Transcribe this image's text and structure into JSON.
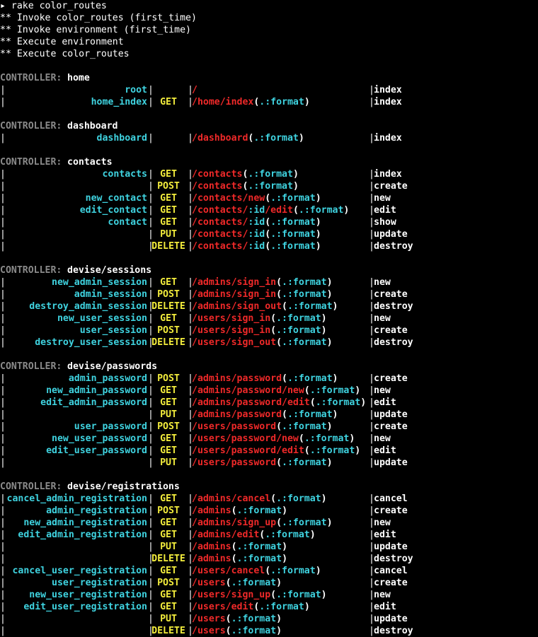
{
  "terminal": {
    "header_lines": [
      "▸ rake color_routes",
      "** Invoke color_routes (first_time)",
      "** Invoke environment (first_time)",
      "** Execute environment",
      "** Execute color_routes"
    ],
    "controller_label": "CONTROLLER:",
    "pipe": "|",
    "controllers": [
      {
        "name": "home",
        "routes": [
          {
            "name": "root",
            "verb": "",
            "path": [
              [
                "r",
                "/"
              ]
            ],
            "action": "index"
          },
          {
            "name": "home_index",
            "verb": "GET",
            "path": [
              [
                "r",
                "/home/index"
              ],
              [
                "w",
                "("
              ],
              [
                "c",
                ".:format"
              ],
              [
                "w",
                ")"
              ]
            ],
            "action": "index"
          }
        ]
      },
      {
        "name": "dashboard",
        "routes": [
          {
            "name": "dashboard",
            "verb": "",
            "path": [
              [
                "r",
                "/dashboard"
              ],
              [
                "w",
                "("
              ],
              [
                "c",
                ".:format"
              ],
              [
                "w",
                ")"
              ]
            ],
            "action": "index"
          }
        ]
      },
      {
        "name": "contacts",
        "routes": [
          {
            "name": "contacts",
            "verb": "GET",
            "path": [
              [
                "r",
                "/contacts"
              ],
              [
                "w",
                "("
              ],
              [
                "c",
                ".:format"
              ],
              [
                "w",
                ")"
              ]
            ],
            "action": "index"
          },
          {
            "name": "",
            "verb": "POST",
            "path": [
              [
                "r",
                "/contacts"
              ],
              [
                "w",
                "("
              ],
              [
                "c",
                ".:format"
              ],
              [
                "w",
                ")"
              ]
            ],
            "action": "create"
          },
          {
            "name": "new_contact",
            "verb": "GET",
            "path": [
              [
                "r",
                "/contacts/new"
              ],
              [
                "w",
                "("
              ],
              [
                "c",
                ".:format"
              ],
              [
                "w",
                ")"
              ]
            ],
            "action": "new"
          },
          {
            "name": "edit_contact",
            "verb": "GET",
            "path": [
              [
                "r",
                "/contacts/"
              ],
              [
                "c",
                ":id"
              ],
              [
                "r",
                "/edit"
              ],
              [
                "w",
                "("
              ],
              [
                "c",
                ".:format"
              ],
              [
                "w",
                ")"
              ]
            ],
            "action": "edit"
          },
          {
            "name": "contact",
            "verb": "GET",
            "path": [
              [
                "r",
                "/contacts/"
              ],
              [
                "c",
                ":id"
              ],
              [
                "w",
                "("
              ],
              [
                "c",
                ".:format"
              ],
              [
                "w",
                ")"
              ]
            ],
            "action": "show"
          },
          {
            "name": "",
            "verb": "PUT",
            "path": [
              [
                "r",
                "/contacts/"
              ],
              [
                "c",
                ":id"
              ],
              [
                "w",
                "("
              ],
              [
                "c",
                ".:format"
              ],
              [
                "w",
                ")"
              ]
            ],
            "action": "update"
          },
          {
            "name": "",
            "verb": "DELETE",
            "path": [
              [
                "r",
                "/contacts/"
              ],
              [
                "c",
                ":id"
              ],
              [
                "w",
                "("
              ],
              [
                "c",
                ".:format"
              ],
              [
                "w",
                ")"
              ]
            ],
            "action": "destroy"
          }
        ]
      },
      {
        "name": "devise/sessions",
        "routes": [
          {
            "name": "new_admin_session",
            "verb": "GET",
            "path": [
              [
                "r",
                "/admins/sign_in"
              ],
              [
                "w",
                "("
              ],
              [
                "c",
                ".:format"
              ],
              [
                "w",
                ")"
              ]
            ],
            "action": "new"
          },
          {
            "name": "admin_session",
            "verb": "POST",
            "path": [
              [
                "r",
                "/admins/sign_in"
              ],
              [
                "w",
                "("
              ],
              [
                "c",
                ".:format"
              ],
              [
                "w",
                ")"
              ]
            ],
            "action": "create"
          },
          {
            "name": "destroy_admin_session",
            "verb": "DELETE",
            "path": [
              [
                "r",
                "/admins/sign_out"
              ],
              [
                "w",
                "("
              ],
              [
                "c",
                ".:format"
              ],
              [
                "w",
                ")"
              ]
            ],
            "action": "destroy"
          },
          {
            "name": "new_user_session",
            "verb": "GET",
            "path": [
              [
                "r",
                "/users/sign_in"
              ],
              [
                "w",
                "("
              ],
              [
                "c",
                ".:format"
              ],
              [
                "w",
                ")"
              ]
            ],
            "action": "new"
          },
          {
            "name": "user_session",
            "verb": "POST",
            "path": [
              [
                "r",
                "/users/sign_in"
              ],
              [
                "w",
                "("
              ],
              [
                "c",
                ".:format"
              ],
              [
                "w",
                ")"
              ]
            ],
            "action": "create"
          },
          {
            "name": "destroy_user_session",
            "verb": "DELETE",
            "path": [
              [
                "r",
                "/users/sign_out"
              ],
              [
                "w",
                "("
              ],
              [
                "c",
                ".:format"
              ],
              [
                "w",
                ")"
              ]
            ],
            "action": "destroy"
          }
        ]
      },
      {
        "name": "devise/passwords",
        "routes": [
          {
            "name": "admin_password",
            "verb": "POST",
            "path": [
              [
                "r",
                "/admins/password"
              ],
              [
                "w",
                "("
              ],
              [
                "c",
                ".:format"
              ],
              [
                "w",
                ")"
              ]
            ],
            "action": "create"
          },
          {
            "name": "new_admin_password",
            "verb": "GET",
            "path": [
              [
                "r",
                "/admins/password/new"
              ],
              [
                "w",
                "("
              ],
              [
                "c",
                ".:format"
              ],
              [
                "w",
                ")"
              ]
            ],
            "action": "new"
          },
          {
            "name": "edit_admin_password",
            "verb": "GET",
            "path": [
              [
                "r",
                "/admins/password/edit"
              ],
              [
                "w",
                "("
              ],
              [
                "c",
                ".:format"
              ],
              [
                "w",
                ")"
              ]
            ],
            "action": "edit"
          },
          {
            "name": "",
            "verb": "PUT",
            "path": [
              [
                "r",
                "/admins/password"
              ],
              [
                "w",
                "("
              ],
              [
                "c",
                ".:format"
              ],
              [
                "w",
                ")"
              ]
            ],
            "action": "update"
          },
          {
            "name": "user_password",
            "verb": "POST",
            "path": [
              [
                "r",
                "/users/password"
              ],
              [
                "w",
                "("
              ],
              [
                "c",
                ".:format"
              ],
              [
                "w",
                ")"
              ]
            ],
            "action": "create"
          },
          {
            "name": "new_user_password",
            "verb": "GET",
            "path": [
              [
                "r",
                "/users/password/new"
              ],
              [
                "w",
                "("
              ],
              [
                "c",
                ".:format"
              ],
              [
                "w",
                ")"
              ]
            ],
            "action": "new"
          },
          {
            "name": "edit_user_password",
            "verb": "GET",
            "path": [
              [
                "r",
                "/users/password/edit"
              ],
              [
                "w",
                "("
              ],
              [
                "c",
                ".:format"
              ],
              [
                "w",
                ")"
              ]
            ],
            "action": "edit"
          },
          {
            "name": "",
            "verb": "PUT",
            "path": [
              [
                "r",
                "/users/password"
              ],
              [
                "w",
                "("
              ],
              [
                "c",
                ".:format"
              ],
              [
                "w",
                ")"
              ]
            ],
            "action": "update"
          }
        ]
      },
      {
        "name": "devise/registrations",
        "routes": [
          {
            "name": "cancel_admin_registration",
            "verb": "GET",
            "path": [
              [
                "r",
                "/admins/cancel"
              ],
              [
                "w",
                "("
              ],
              [
                "c",
                ".:format"
              ],
              [
                "w",
                ")"
              ]
            ],
            "action": "cancel"
          },
          {
            "name": "admin_registration",
            "verb": "POST",
            "path": [
              [
                "r",
                "/admins"
              ],
              [
                "w",
                "("
              ],
              [
                "c",
                ".:format"
              ],
              [
                "w",
                ")"
              ]
            ],
            "action": "create"
          },
          {
            "name": "new_admin_registration",
            "verb": "GET",
            "path": [
              [
                "r",
                "/admins/sign_up"
              ],
              [
                "w",
                "("
              ],
              [
                "c",
                ".:format"
              ],
              [
                "w",
                ")"
              ]
            ],
            "action": "new"
          },
          {
            "name": "edit_admin_registration",
            "verb": "GET",
            "path": [
              [
                "r",
                "/admins/edit"
              ],
              [
                "w",
                "("
              ],
              [
                "c",
                ".:format"
              ],
              [
                "w",
                ")"
              ]
            ],
            "action": "edit"
          },
          {
            "name": "",
            "verb": "PUT",
            "path": [
              [
                "r",
                "/admins"
              ],
              [
                "w",
                "("
              ],
              [
                "c",
                ".:format"
              ],
              [
                "w",
                ")"
              ]
            ],
            "action": "update"
          },
          {
            "name": "",
            "verb": "DELETE",
            "path": [
              [
                "r",
                "/admins"
              ],
              [
                "w",
                "("
              ],
              [
                "c",
                ".:format"
              ],
              [
                "w",
                ")"
              ]
            ],
            "action": "destroy"
          },
          {
            "name": "cancel_user_registration",
            "verb": "GET",
            "path": [
              [
                "r",
                "/users/cancel"
              ],
              [
                "w",
                "("
              ],
              [
                "c",
                ".:format"
              ],
              [
                "w",
                ")"
              ]
            ],
            "action": "cancel"
          },
          {
            "name": "user_registration",
            "verb": "POST",
            "path": [
              [
                "r",
                "/users"
              ],
              [
                "w",
                "("
              ],
              [
                "c",
                ".:format"
              ],
              [
                "w",
                ")"
              ]
            ],
            "action": "create"
          },
          {
            "name": "new_user_registration",
            "verb": "GET",
            "path": [
              [
                "r",
                "/users/sign_up"
              ],
              [
                "w",
                "("
              ],
              [
                "c",
                ".:format"
              ],
              [
                "w",
                ")"
              ]
            ],
            "action": "new"
          },
          {
            "name": "edit_user_registration",
            "verb": "GET",
            "path": [
              [
                "r",
                "/users/edit"
              ],
              [
                "w",
                "("
              ],
              [
                "c",
                ".:format"
              ],
              [
                "w",
                ")"
              ]
            ],
            "action": "edit"
          },
          {
            "name": "",
            "verb": "PUT",
            "path": [
              [
                "r",
                "/users"
              ],
              [
                "w",
                "("
              ],
              [
                "c",
                ".:format"
              ],
              [
                "w",
                ")"
              ]
            ],
            "action": "update"
          },
          {
            "name": "",
            "verb": "DELETE",
            "path": [
              [
                "r",
                "/users"
              ],
              [
                "w",
                "("
              ],
              [
                "c",
                ".:format"
              ],
              [
                "w",
                ")"
              ]
            ],
            "action": "destroy"
          }
        ]
      }
    ]
  }
}
